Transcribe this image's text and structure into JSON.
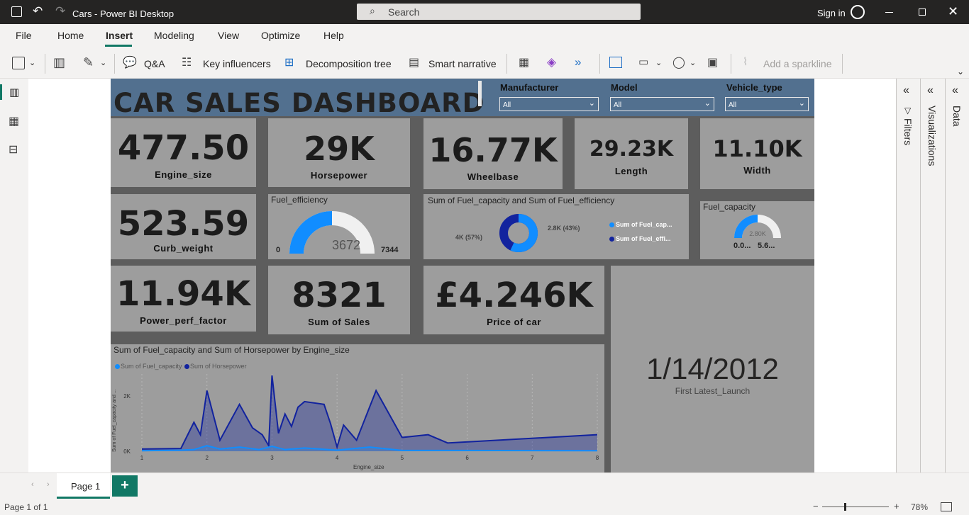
{
  "titlebar": {
    "title": "Cars - Power BI Desktop",
    "search_placeholder": "Search",
    "signin": "Sign in"
  },
  "menu": [
    "File",
    "Home",
    "Insert",
    "Modeling",
    "View",
    "Optimize",
    "Help"
  ],
  "ribbon": {
    "qa": "Q&A",
    "key_influencers": "Key influencers",
    "decomposition_tree": "Decomposition tree",
    "smart_narrative": "Smart narrative",
    "add_sparkline": "Add a sparkline"
  },
  "dashboard": {
    "title": "CAR SALES DASHBOARD",
    "slicers": [
      {
        "label": "Manufacturer",
        "value": "All"
      },
      {
        "label": "Model",
        "value": "All"
      },
      {
        "label": "Vehicle_type",
        "value": "All"
      }
    ],
    "cards": {
      "engine_size": {
        "value": "477.50",
        "label": "Engine_size"
      },
      "horsepower": {
        "value": "29K",
        "label": "Horsepower"
      },
      "wheelbase": {
        "value": "16.77K",
        "label": "Wheelbase"
      },
      "length": {
        "value": "29.23K",
        "label": "Length"
      },
      "width": {
        "value": "11.10K",
        "label": "Width"
      },
      "curb_weight": {
        "value": "523.59",
        "label": "Curb_weight"
      },
      "power_perf": {
        "value": "11.94K",
        "label": "Power_perf_factor"
      },
      "sales": {
        "value": "8321",
        "label": "Sum of Sales"
      },
      "price": {
        "value": "£4.246K",
        "label": "Price of car"
      }
    },
    "gauge_fuel_eff": {
      "title": "Fuel_efficiency",
      "value": "3672",
      "min": "0",
      "max": "7344",
      "fraction": 0.5
    },
    "donut": {
      "title": "Sum of Fuel_capacity and Sum of Fuel_efficiency",
      "label_left": "4K (57%)",
      "label_right": "2.8K (43%)",
      "legend": [
        "Sum of Fuel_cap...",
        "Sum of Fuel_effi..."
      ],
      "colors": [
        "#118dff",
        "#12239e"
      ]
    },
    "gauge_fuel_cap": {
      "title": "Fuel_capacity",
      "value": "2.80K",
      "min": "0.0...",
      "max": "5.6...",
      "fraction": 0.5
    },
    "date_card": {
      "value": "1/14/2012",
      "label": "First Latest_Launch"
    }
  },
  "chart_data": {
    "type": "area",
    "title": "Sum of Fuel_capacity and Sum of Horsepower by Engine_size",
    "xlabel": "Engine_size",
    "ylabel": "Sum of Fuel_capacity and ...",
    "xlim": [
      1,
      8
    ],
    "ylim": [
      0,
      2800
    ],
    "x_ticks": [
      "1",
      "2",
      "3",
      "4",
      "5",
      "6",
      "7",
      "8"
    ],
    "y_ticks": [
      "0K",
      "2K"
    ],
    "legend_position": "top-left",
    "series": [
      {
        "name": "Sum of Fuel_capacity",
        "color": "#118dff",
        "x": [
          1,
          1.6,
          1.8,
          2,
          2.2,
          2.5,
          2.8,
          3,
          3.2,
          3.5,
          4,
          4.5,
          5,
          8
        ],
        "y": [
          20,
          40,
          60,
          200,
          80,
          150,
          60,
          180,
          60,
          120,
          40,
          150,
          30,
          20
        ]
      },
      {
        "name": "Sum of Horsepower",
        "color": "#12239e",
        "x": [
          1,
          1.6,
          1.8,
          1.9,
          2.0,
          2.2,
          2.5,
          2.7,
          2.85,
          2.95,
          3.0,
          3.1,
          3.2,
          3.3,
          3.4,
          3.5,
          3.8,
          3.9,
          4.0,
          4.1,
          4.3,
          4.6,
          5.0,
          5.4,
          5.7,
          8.0
        ],
        "y": [
          80,
          100,
          1050,
          600,
          2200,
          400,
          1700,
          850,
          600,
          200,
          2750,
          650,
          1350,
          900,
          1600,
          1800,
          1700,
          1000,
          150,
          950,
          400,
          2200,
          500,
          600,
          300,
          600
        ]
      }
    ]
  },
  "pages": {
    "current": "Page 1",
    "add": "+"
  },
  "status": {
    "page_info": "Page 1 of 1",
    "zoom": "78%",
    "minus": "−",
    "plus": "+"
  },
  "panes": {
    "filters": "Filters",
    "visualizations": "Visualizations",
    "data": "Data"
  }
}
